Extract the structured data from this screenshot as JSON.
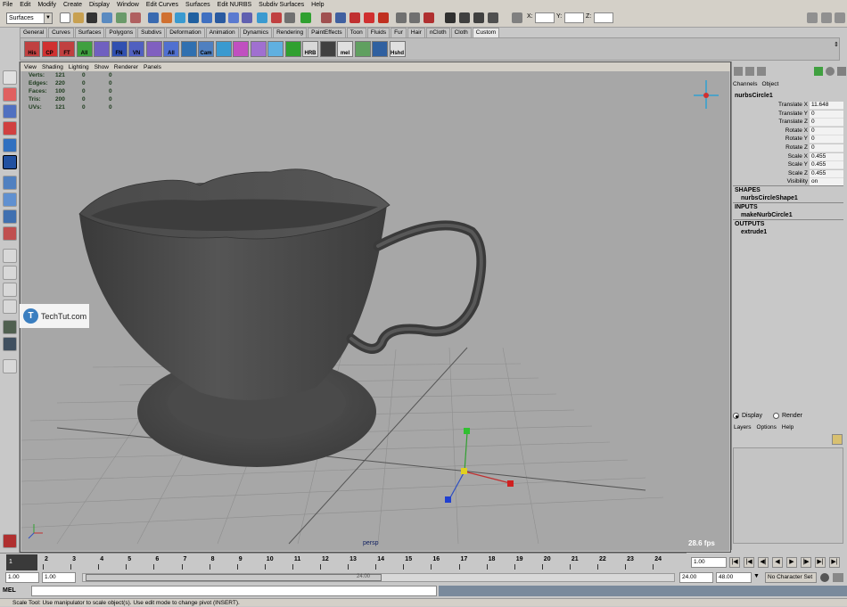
{
  "menu": [
    "File",
    "Edit",
    "Modify",
    "Create",
    "Display",
    "Window",
    "Edit Curves",
    "Surfaces",
    "Edit NURBS",
    "Subdiv Surfaces",
    "Help"
  ],
  "status_line": {
    "mode": "Surfaces",
    "coord_labels": [
      "X:",
      "Y:",
      "Z:"
    ]
  },
  "shelf_tabs": [
    "General",
    "Curves",
    "Surfaces",
    "Polygons",
    "Subdivs",
    "Deformation",
    "Animation",
    "Dynamics",
    "Rendering",
    "PaintEffects",
    "Toon",
    "Fluids",
    "Fur",
    "Hair",
    "nCloth",
    "Cloth",
    "Custom"
  ],
  "shelf_active_tab": "Custom",
  "shelf_icons": [
    "His",
    "CP",
    "FT",
    "All",
    "",
    "FN",
    "VN",
    "",
    "All",
    "",
    "Cam",
    "",
    "",
    "",
    "",
    "",
    "HRB",
    "",
    "mel",
    "",
    "",
    "Hshd"
  ],
  "panel_menu": [
    "View",
    "Shading",
    "Lighting",
    "Show",
    "Renderer",
    "Panels"
  ],
  "hud": [
    {
      "label": "Verts:",
      "values": [
        "121",
        "0",
        "0"
      ]
    },
    {
      "label": "Edges:",
      "values": [
        "220",
        "0",
        "0"
      ]
    },
    {
      "label": "Faces:",
      "values": [
        "100",
        "0",
        "0"
      ]
    },
    {
      "label": "Tris:",
      "values": [
        "200",
        "0",
        "0"
      ]
    },
    {
      "label": "UVs:",
      "values": [
        "121",
        "0",
        "0"
      ]
    }
  ],
  "fps": "28.6 fps",
  "camera": "persp",
  "watermark": "TechTut.com",
  "watermark_logo": "T",
  "channel_box": {
    "menu": [
      "Channels",
      "Object"
    ],
    "object": "nurbsCircle1",
    "attributes": [
      {
        "name": "Translate X",
        "value": "11.648"
      },
      {
        "name": "Translate Y",
        "value": "0"
      },
      {
        "name": "Translate Z",
        "value": "0"
      },
      {
        "name": "Rotate X",
        "value": "0"
      },
      {
        "name": "Rotate Y",
        "value": "0"
      },
      {
        "name": "Rotate Z",
        "value": "0"
      },
      {
        "name": "Scale X",
        "value": "0.455"
      },
      {
        "name": "Scale Y",
        "value": "0.455"
      },
      {
        "name": "Scale Z",
        "value": "0.455"
      },
      {
        "name": "Visibility",
        "value": "on"
      }
    ],
    "shapes_header": "SHAPES",
    "shape": "nurbsCircleShape1",
    "inputs_header": "INPUTS",
    "input": "makeNurbCircle1",
    "outputs_header": "OUTPUTS",
    "output": "extrude1"
  },
  "layer_editor": {
    "radio_display": "Display",
    "radio_render": "Render",
    "selected": "Display",
    "menu": [
      "Layers",
      "Options",
      "Help"
    ]
  },
  "time_slider": {
    "ticks": [
      "1",
      "2",
      "3",
      "4",
      "5",
      "6",
      "7",
      "8",
      "9",
      "10",
      "11",
      "12",
      "13",
      "14",
      "15",
      "16",
      "17",
      "18",
      "19",
      "20",
      "21",
      "22",
      "23",
      "24"
    ],
    "current_frame": "1",
    "current_time_field": "1.00"
  },
  "range_slider": {
    "start": "1.00",
    "start_inner": "1.00",
    "range_label": "24.00",
    "end_inner": "24.00",
    "end": "48.00",
    "character_set": "No Character Set"
  },
  "command_line": {
    "label": "MEL"
  },
  "help_line": "Scale Tool: Use manipulator to scale object(s). Use edit mode to change pivot (INSERT).",
  "colors": {
    "viewport_bg": "#a7a7a7",
    "ui_bg": "#c8c8c8",
    "cup": "#4a4a4a",
    "manip_x": "#d02020",
    "manip_y": "#20b020",
    "manip_z": "#2040d0"
  }
}
